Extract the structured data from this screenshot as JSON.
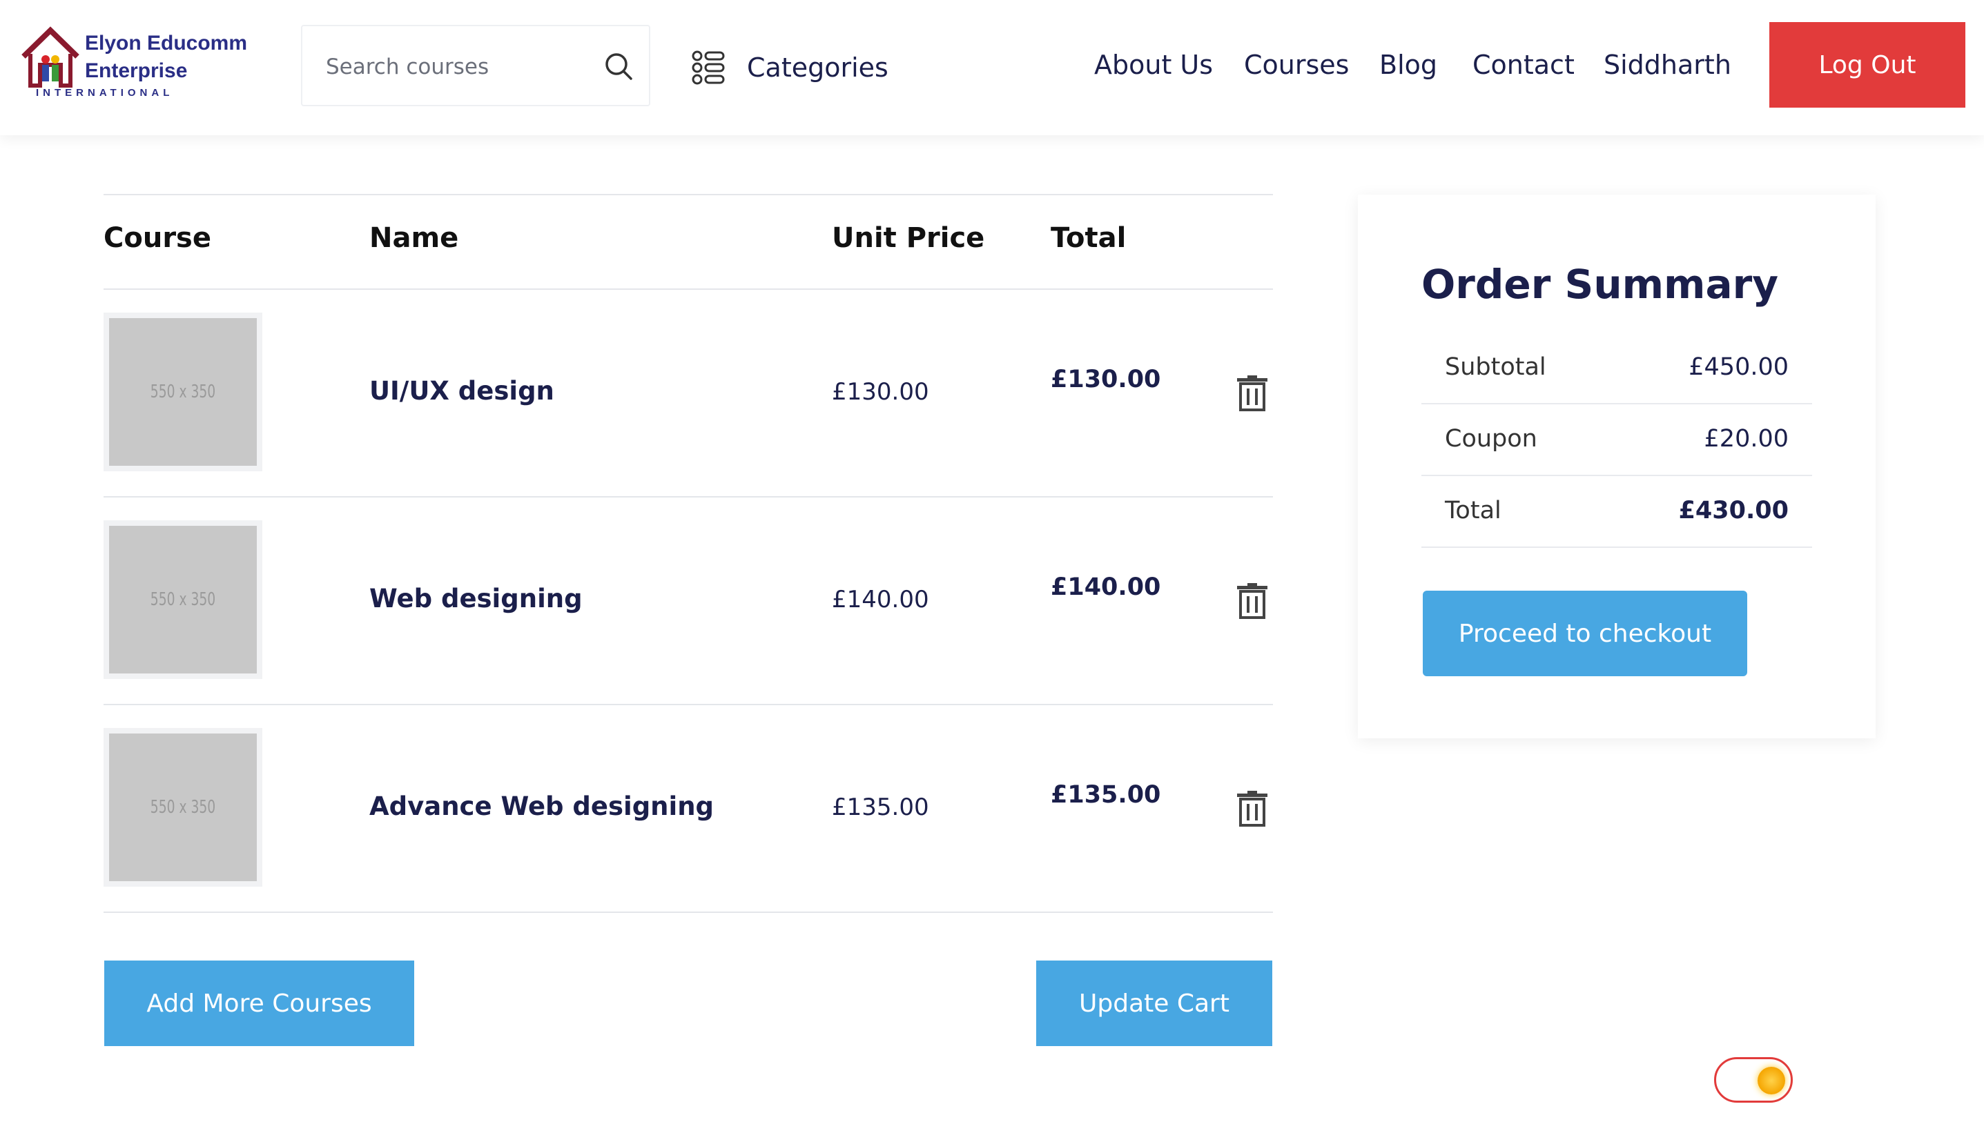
{
  "brand": {
    "line1": "Elyon Educomm",
    "line2": "Enterprise",
    "line3": "INTERNATIONAL"
  },
  "search": {
    "placeholder": "Search courses"
  },
  "categories_label": "Categories",
  "nav": {
    "items": [
      "About Us",
      "Courses",
      "Blog",
      "Contact",
      "Siddharth"
    ],
    "logout": "Log Out"
  },
  "cart": {
    "headers": {
      "course": "Course",
      "name": "Name",
      "unit_price": "Unit Price",
      "total": "Total"
    },
    "items": [
      {
        "thumb": "550 x 350",
        "name": "UI/UX design",
        "unit_price": "£130.00",
        "total": "£130.00"
      },
      {
        "thumb": "550 x 350",
        "name": "Web designing",
        "unit_price": "£140.00",
        "total": "£140.00"
      },
      {
        "thumb": "550 x 350",
        "name": "Advance Web designing",
        "unit_price": "£135.00",
        "total": "£135.00"
      }
    ],
    "add_more": "Add More Courses",
    "update": "Update Cart"
  },
  "summary": {
    "title": "Order Summary",
    "rows": [
      {
        "label": "Subtotal",
        "value": "£450.00"
      },
      {
        "label": "Coupon",
        "value": "£20.00"
      },
      {
        "label": "Total",
        "value": "£430.00"
      }
    ],
    "checkout": "Proceed to checkout"
  },
  "colors": {
    "brand_navy": "#1b1f4b",
    "logout_red": "#e23b3b",
    "button_blue": "#48a7e2"
  }
}
